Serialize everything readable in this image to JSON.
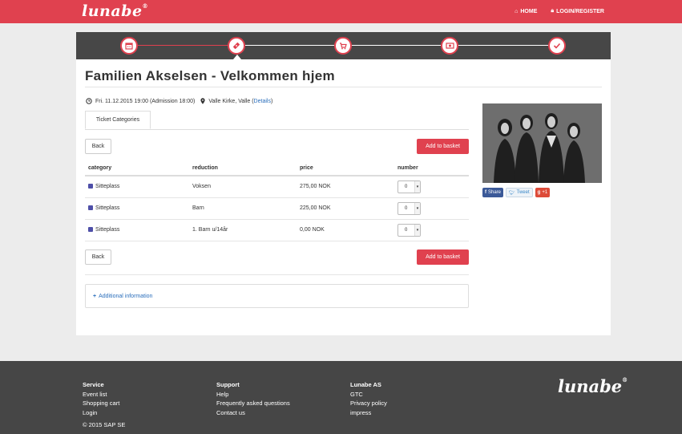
{
  "header": {
    "logo_text": "lunabe",
    "nav": [
      {
        "icon": "home-icon",
        "label": "HOME"
      },
      {
        "icon": "lock-icon",
        "label": "LOGIN/REGISTER"
      }
    ]
  },
  "steps": {
    "items": [
      {
        "icon": "calendar-icon"
      },
      {
        "icon": "ticket-icon",
        "active": true
      },
      {
        "icon": "cart-icon"
      },
      {
        "icon": "payment-icon"
      },
      {
        "icon": "checkmark-icon"
      }
    ]
  },
  "event": {
    "title": "Familien Akselsen - Velkommen hjem",
    "date": "Fri. 11.12.2015 19:00 (Admission 18:00)",
    "venue": "Valle Kirke, Valle (",
    "details_link": "Details",
    "venue_close": ")"
  },
  "tabs": {
    "ticket_categories": "Ticket Categories"
  },
  "buttons": {
    "back": "Back",
    "add_to_basket": "Add to basket"
  },
  "table": {
    "headers": [
      "category",
      "reduction",
      "price",
      "number"
    ],
    "rows": [
      {
        "category": "Sitteplass",
        "reduction": "Voksen",
        "price": "275,00 NOK",
        "number": "0"
      },
      {
        "category": "Sitteplass",
        "reduction": "Barn",
        "price": "225,00 NOK",
        "number": "0"
      },
      {
        "category": "Sitteplass",
        "reduction": "1. Barn u/14år",
        "price": "0,00 NOK",
        "number": "0"
      }
    ]
  },
  "additional_info": "Additional information",
  "social": {
    "share": "Share",
    "tweet": "Tweet",
    "plus": "+1"
  },
  "footer": {
    "service": {
      "heading": "Service",
      "links": [
        "Event list",
        "Shopping cart",
        "Login"
      ]
    },
    "support": {
      "heading": "Support",
      "links": [
        "Help",
        "Frequently asked questions",
        "Contact us"
      ]
    },
    "company": {
      "heading": "Lunabe AS",
      "links": [
        "GTC",
        "Privacy policy",
        "impress"
      ]
    },
    "copyright": "© 2015 SAP SE",
    "logo_text": "lunabe"
  },
  "colors": {
    "accent": "#e0414f",
    "step_bar": "#474747",
    "footer": "#464646",
    "category_swatch": "#4e4fa8"
  }
}
